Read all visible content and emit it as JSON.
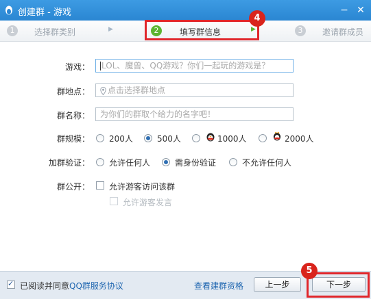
{
  "window": {
    "title": "创建群 - 游戏"
  },
  "steps": [
    {
      "num": "1",
      "label": "选择群类别"
    },
    {
      "num": "2",
      "label": "填写群信息"
    },
    {
      "num": "3",
      "label": "邀请群成员"
    }
  ],
  "annotations": {
    "step_badge": "4",
    "next_badge": "5"
  },
  "form": {
    "game_label": "游戏：",
    "game_placeholder": "LOL、魔兽、QQ游戏？你们一起玩的游戏是？",
    "location_label": "群地点：",
    "location_placeholder": "点击选择群地点",
    "name_label": "群名称：",
    "name_placeholder": "为你们的群取个给力的名字吧！",
    "size_label": "群规模：",
    "size_options": [
      "200人",
      "500人",
      "1000人",
      "2000人"
    ],
    "size_selected": "500人",
    "verify_label": "加群验证：",
    "verify_options": [
      "允许任何人",
      "需身份验证",
      "不允许任何人"
    ],
    "verify_selected": "需身份验证",
    "public_label": "群公开：",
    "public_visitor": "允许游客访问该群",
    "public_visitor_speak": "允许游客发言"
  },
  "footer": {
    "agree_prefix": "已阅读并同意",
    "agree_link": "QQ群服务协议",
    "qualify_link": "查看建群资格",
    "prev_button": "上一步",
    "next_button": "下一步"
  },
  "colors": {
    "titlebar": "#2a86d2",
    "accent_green": "#5cb531",
    "annotation_red": "#e0262b",
    "link": "#1f66b0"
  }
}
